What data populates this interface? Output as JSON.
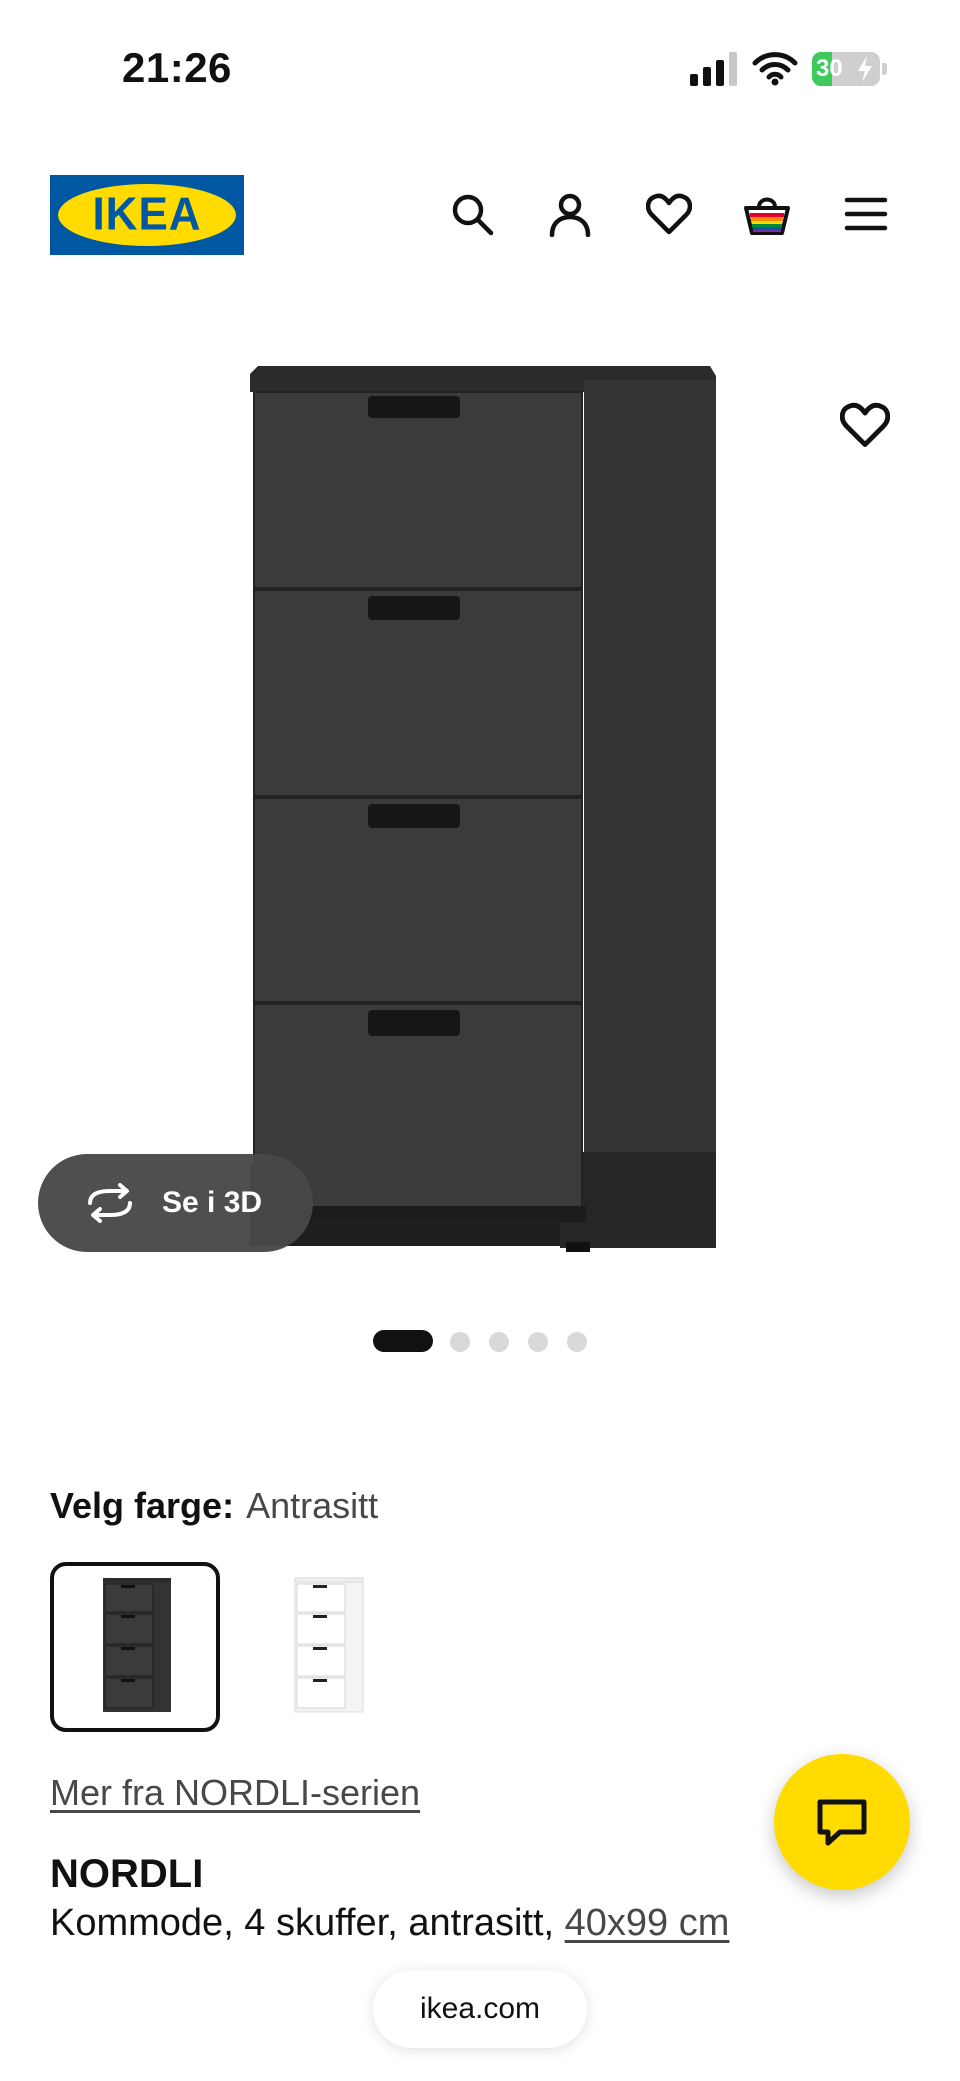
{
  "status_bar": {
    "time": "21:26",
    "battery_level": "30",
    "battery_fraction": 0.3,
    "battery_state": "charging",
    "icons": [
      "cellular-signal-icon",
      "wifi-icon",
      "battery-icon"
    ]
  },
  "header": {
    "logo_text": "IKEA",
    "brand_colors": {
      "blue": "#0058a3",
      "yellow": "#ffdb00"
    },
    "icons": [
      "search-icon",
      "account-icon",
      "heart-icon",
      "shopping-bag-icon",
      "menu-icon"
    ]
  },
  "gallery": {
    "view_3d_label": "Se i 3D",
    "image_count": 5,
    "active_index": 0,
    "product_color": "#3b3b3d"
  },
  "color_selection": {
    "label": "Velg farge:",
    "selected_value": "Antrasitt",
    "swatches": [
      {
        "name": "Antrasitt",
        "color": "#3b3b3d",
        "selected": true
      },
      {
        "name": "Hvit",
        "color": "#ffffff",
        "selected": false
      }
    ]
  },
  "product": {
    "series_link": "Mer fra NORDLI-serien",
    "name": "NORDLI",
    "description": "Kommode, 4 skuffer, antrasitt, ",
    "size_link": "40x99 cm"
  },
  "chat": {
    "icon": "chat-bubble-icon",
    "color": "#ffdb00"
  },
  "browser": {
    "url": "ikea.com"
  }
}
